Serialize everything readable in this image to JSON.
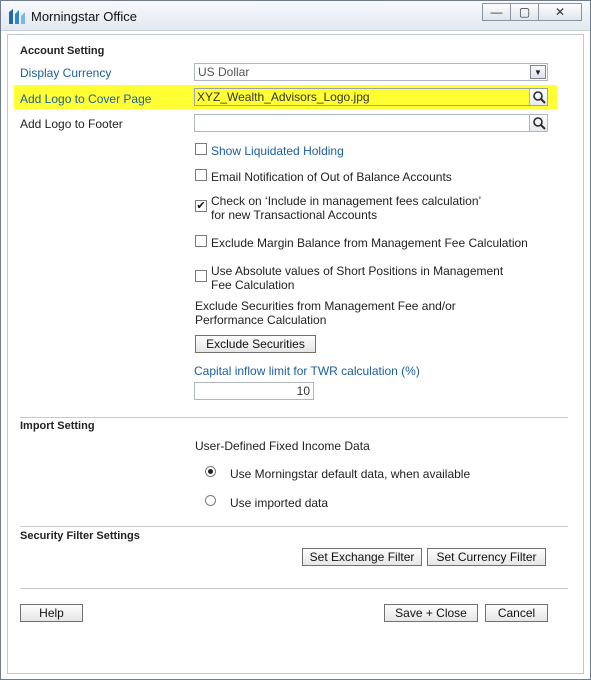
{
  "window": {
    "title": "Morningstar Office",
    "controls": {
      "minimize": "—",
      "maximize": "▢",
      "close": "✕"
    }
  },
  "account_setting": {
    "section_title": "Account Setting",
    "display_currency": {
      "label": "Display Currency",
      "value": "US Dollar"
    },
    "logo_cover": {
      "label": "Add Logo to Cover Page",
      "value": "XYZ_Wealth_Advisors_Logo.jpg"
    },
    "logo_footer": {
      "label": "Add Logo to Footer",
      "value": ""
    },
    "checkboxes": [
      {
        "label": "Show Liquidated Holding",
        "checked": false
      },
      {
        "label": "Email Notification of Out of Balance Accounts",
        "checked": false
      },
      {
        "label_line1": "Check on ‘Include in management fees calculation’",
        "label_line2": "for new Transactional Accounts",
        "checked": true
      },
      {
        "label": "Exclude Margin Balance from Management Fee Calculation",
        "checked": false
      },
      {
        "label_line1": "Use Absolute values of Short Positions in Management",
        "label_line2": "Fee Calculation",
        "checked": false
      }
    ],
    "exclude_text_line1": "Exclude Securities from Management Fee and/or",
    "exclude_text_line2": "Performance Calculation",
    "exclude_button": "Exclude Securities",
    "capital_inflow_label": "Capital inflow limit for TWR calculation (%)",
    "capital_inflow_value": "10"
  },
  "import_setting": {
    "section_title": "Import Setting",
    "subtitle": "User-Defined Fixed Income Data",
    "options": [
      {
        "label": "Use Morningstar default data, when available",
        "selected": true
      },
      {
        "label": "Use imported data",
        "selected": false
      }
    ]
  },
  "security_filter": {
    "section_title": "Security Filter Settings",
    "exchange_button": "Set Exchange Filter",
    "currency_button": "Set Currency Filter"
  },
  "footer": {
    "help": "Help",
    "save_close": "Save + Close",
    "cancel": "Cancel"
  },
  "colors": {
    "highlight": "#ffff33",
    "link_blue": "#1c5ea0"
  }
}
